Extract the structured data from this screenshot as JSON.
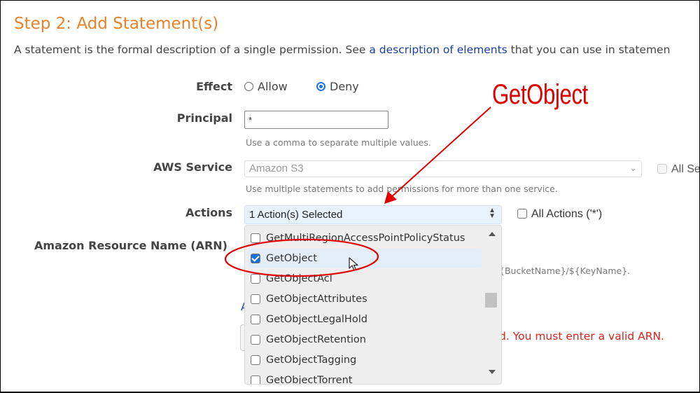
{
  "header": {
    "title": "Step 2: Add Statement(s)",
    "intro_prefix": "A statement is the formal description of a single permission. See ",
    "intro_link": "a description of elements",
    "intro_suffix": " that you can use in statemen"
  },
  "form": {
    "effect": {
      "label": "Effect",
      "options": [
        {
          "label": "Allow",
          "selected": false
        },
        {
          "label": "Deny",
          "selected": true
        }
      ]
    },
    "principal": {
      "label": "Principal",
      "value": "*",
      "hint": "Use a comma to separate multiple values."
    },
    "aws_service": {
      "label": "AWS Service",
      "value": "Amazon S3",
      "hint": "Use multiple statements to add permissions for more than one service.",
      "all_services_label": "All Se",
      "all_services_checked": false
    },
    "actions": {
      "label": "Actions",
      "value": "1 Action(s) Selected",
      "all_actions_label": "All Actions ('*')",
      "all_actions_checked": false,
      "options": [
        {
          "label": "GetMultiRegionAccessPointPolicyStatus",
          "checked": false
        },
        {
          "label": "GetObject",
          "checked": true
        },
        {
          "label": "GetObjectAcl",
          "checked": false
        },
        {
          "label": "GetObjectAttributes",
          "checked": false
        },
        {
          "label": "GetObjectLegalHold",
          "checked": false
        },
        {
          "label": "GetObjectRetention",
          "checked": false
        },
        {
          "label": "GetObjectTagging",
          "checked": false
        },
        {
          "label": "GetObjectTorrent",
          "checked": false
        }
      ]
    },
    "arn": {
      "label": "Amazon Resource Name (ARN)",
      "hint_fragment": "{BucketName}/${KeyName}.",
      "link_fragment": "A",
      "error_fragment": "d. You must enter a valid ARN."
    }
  },
  "annotation": {
    "text": "GetObject",
    "color": "#e00000"
  },
  "colors": {
    "title": "#e8812a",
    "link": "#1a3fa0",
    "error": "#e0201a",
    "accent": "#1a73e8"
  }
}
